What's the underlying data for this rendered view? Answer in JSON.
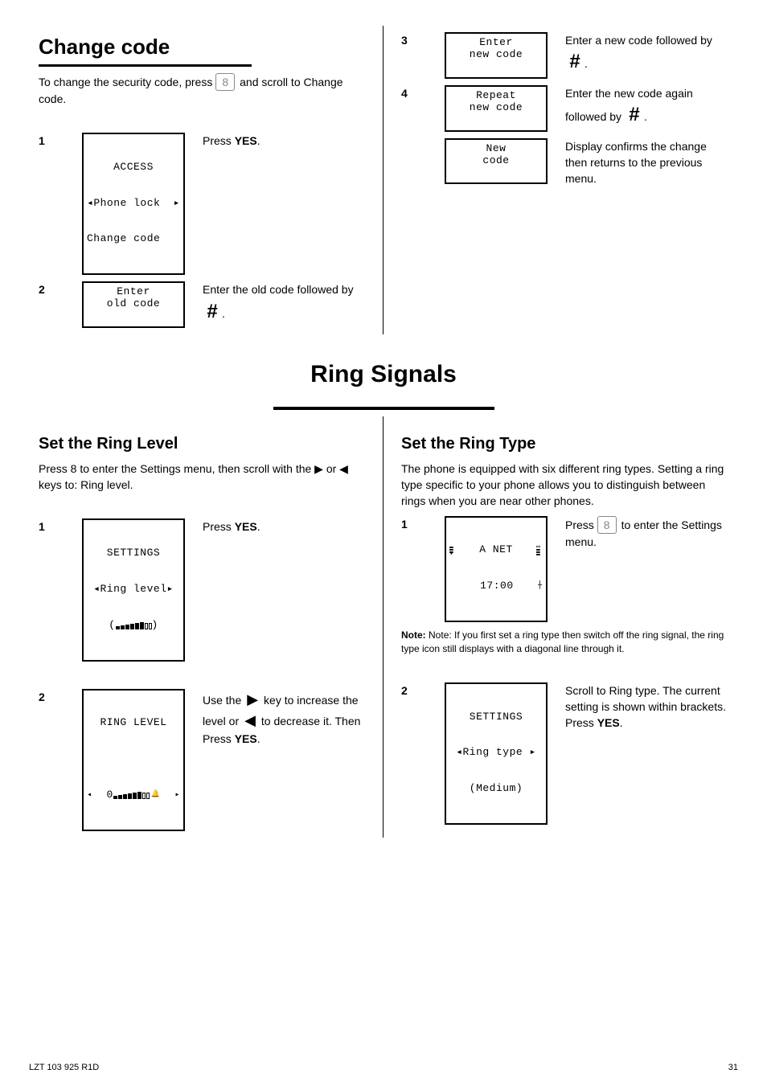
{
  "section_change_code": {
    "heading": "Change code",
    "intro_prefix": "To change the security code, press ",
    "intro_key": "8",
    "intro_suffix": " and scroll to Change code.",
    "step1": {
      "num": "1",
      "lcd_line1": "ACCESS",
      "lcd_line2_left": "◂Phone lock",
      "lcd_line2_right": "▸",
      "lcd_line3": "Change code",
      "action": "Press YES."
    },
    "step2": {
      "num": "2",
      "lcd_line1": "Enter",
      "lcd_line2": "old code",
      "action": "Enter the old code followed by #."
    },
    "step3": {
      "num": "3",
      "lcd_line1": "Enter",
      "lcd_line2": "new code",
      "action": "Enter a new code followed by #."
    },
    "step4": {
      "num": "4",
      "lcd_line1": "Repeat",
      "lcd_line2": "new code",
      "action": "Enter the new code again followed by #."
    },
    "confirm": {
      "lcd_line1": "New",
      "lcd_line2": "code",
      "text": "Display confirms the change then returns to the previous menu."
    }
  },
  "ring_signals_title": "Ring Signals",
  "intro_press8": "Press 8 to enter the Settings menu, then scroll with the ▶ or ◀ keys to:",
  "ring_level": {
    "heading": "Set the Ring Level",
    "intro_suffix": " Ring level.",
    "step1": {
      "num": "1",
      "lcd_line1": "SETTINGS",
      "lcd_line2": "◂Ring level▸",
      "action": "Press YES."
    },
    "step2": {
      "num": "2",
      "lcd_line1": "RING LEVEL",
      "action": "Use the ▶ key to increase the level or ◀ to decrease it. Then Press YES."
    }
  },
  "ring_type": {
    "heading": "Set the Ring Type",
    "intro": "The phone is equipped with six different ring types. Setting a ring type specific to your phone allows you to distinguish between rings when you are near other phones.",
    "note": "Note: If you first set a ring type then switch off the ring signal, the ring type icon still displays with a diagonal line through it.",
    "step1": {
      "num": "1",
      "lcd_top_center": "A NET",
      "lcd_bottom_center": "17:00",
      "action": "Press 8 to enter the Settings menu."
    },
    "step2": {
      "num": "2",
      "lcd_line1": "SETTINGS",
      "lcd_line2": "◂Ring type ▸",
      "lcd_line3": "(Medium)",
      "action": "Scroll to Ring type. The current setting is shown within brackets. Press YES."
    }
  },
  "footer_left": "LZT 103 925 R1D",
  "footer_right": "31"
}
